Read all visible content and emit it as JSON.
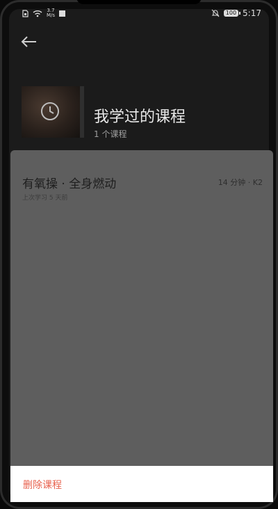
{
  "status_bar": {
    "speed_value": "3.7",
    "speed_unit": "M/s",
    "battery": "100",
    "time": "5:17"
  },
  "header": {
    "title": "我学过的课程",
    "count": "1 个课程"
  },
  "courses": [
    {
      "title": "有氧操 · 全身燃动",
      "meta": "14 分钟 · K2",
      "last_studied": "上次学习 5 天前"
    }
  ],
  "action_sheet": {
    "delete_label": "删除课程"
  },
  "colors": {
    "delete_text": "#e8624e",
    "overlay": "#5e5e5e",
    "background": "#1b1b1b"
  }
}
